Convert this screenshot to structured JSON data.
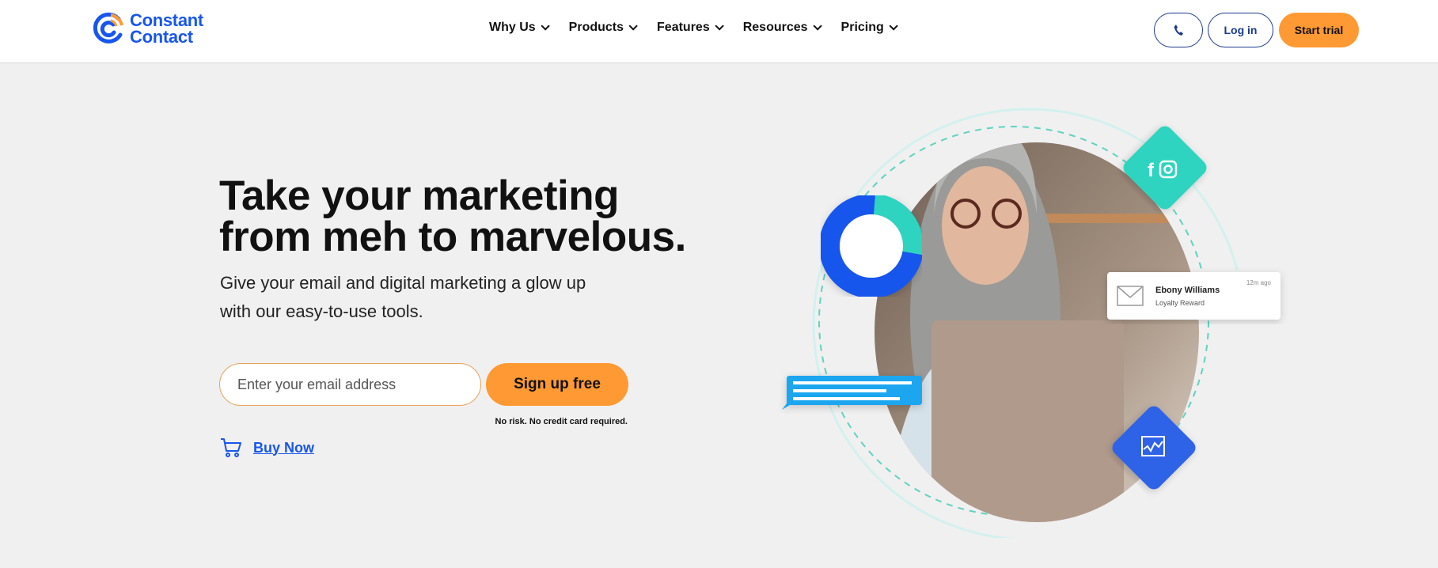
{
  "brand": {
    "name_line1": "Constant",
    "name_line2": "Contact",
    "color": "#1856ed"
  },
  "nav": {
    "items": [
      {
        "label": "Why Us"
      },
      {
        "label": "Products"
      },
      {
        "label": "Features"
      },
      {
        "label": "Resources"
      },
      {
        "label": "Pricing"
      }
    ]
  },
  "header_actions": {
    "phone_icon": "phone-icon",
    "login": "Log in",
    "start_trial": "Start trial",
    "accent": "#ff9933"
  },
  "hero": {
    "headline_line1": "Take your marketing",
    "headline_line2": "from meh to marvelous.",
    "subtitle_line1": "Give your email and digital marketing a glow up",
    "subtitle_line2": "with our easy-to-use tools.",
    "email_placeholder": "Enter your email address",
    "signup_button": "Sign up free",
    "disclaimer": "No risk. No credit card required.",
    "buy_now": "Buy Now"
  },
  "illustration": {
    "notification": {
      "name": "Ebony Williams",
      "subject": "Loyalty Reward",
      "time": "12m ago"
    },
    "social_icons": [
      "facebook-icon",
      "instagram-icon"
    ],
    "chart_icon": "analytics-chart-icon"
  }
}
